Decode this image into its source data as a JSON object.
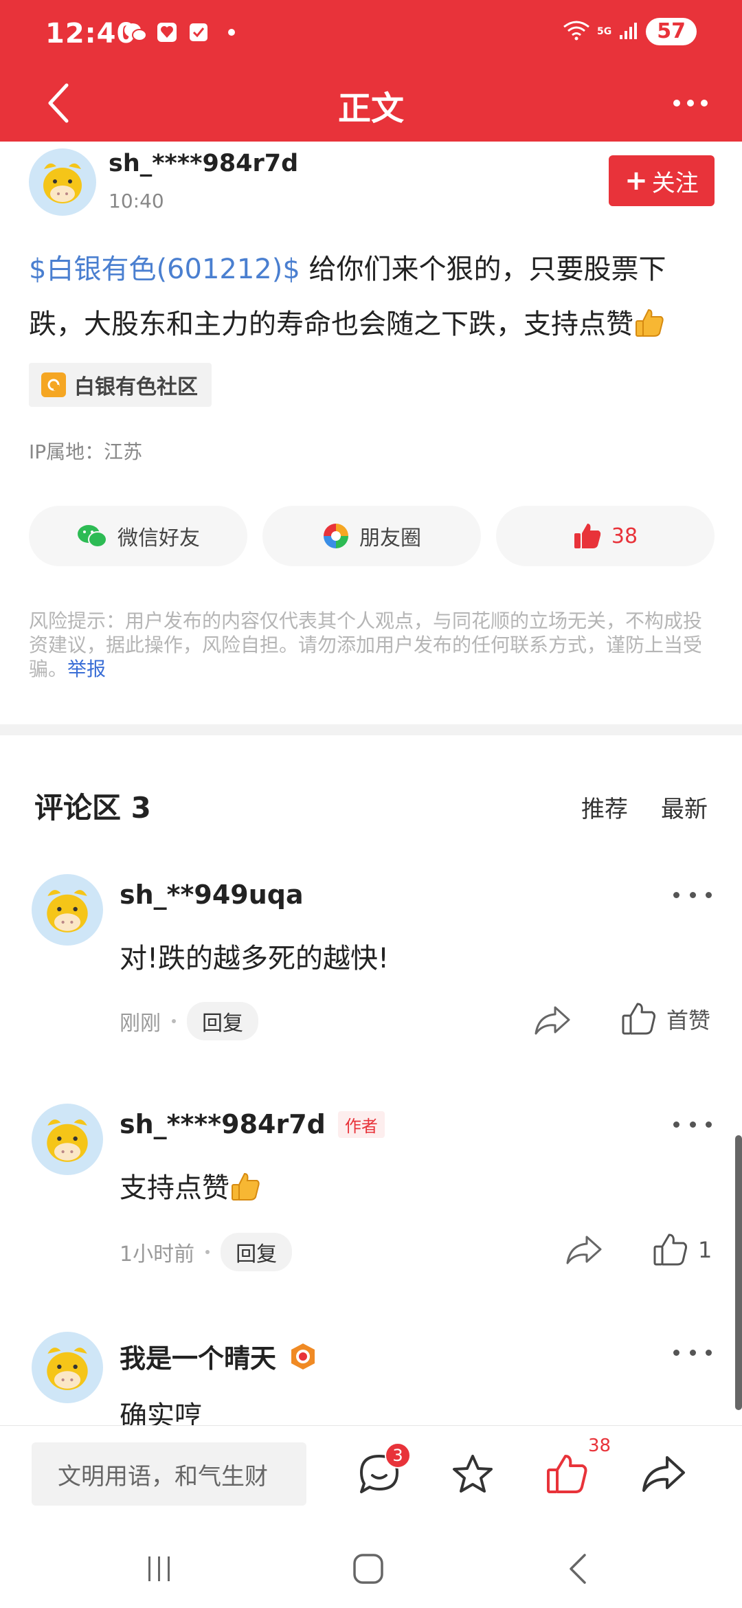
{
  "status_bar": {
    "time": "12:40",
    "network_label": "5G",
    "battery": "57"
  },
  "header": {
    "title": "正文"
  },
  "post": {
    "author": "sh_****984r7d",
    "time": "10:40",
    "follow_label": "关注",
    "stock_tag": "$白银有色(601212)$",
    "text": " 给你们来个狠的，只要股票下跌，大股东和主力的寿命也会随之下跌，支持点赞",
    "community": "白银有色社区",
    "ip_location": "IP属地：江苏",
    "share": {
      "wechat": "微信好友",
      "moments": "朋友圈",
      "likes": "38"
    },
    "risk_notice": "风险提示：用户发布的内容仅代表其个人观点，与同花顺的立场无关，不构成投资建议，据此操作，风险自担。请勿添加用户发布的任何联系方式，谨防上当受骗。",
    "report_label": "举报"
  },
  "comments_section": {
    "title": "评论区 3",
    "sort_recommend": "推荐",
    "sort_newest": "最新",
    "comments": [
      {
        "name": "sh_**949uqa",
        "text": "对!跌的越多死的越快!",
        "time": "刚刚",
        "reply": "回复",
        "like": "首赞"
      },
      {
        "name": "sh_****984r7d",
        "badge": "作者",
        "text": "支持点赞",
        "time": "1小时前",
        "reply": "回复",
        "like": "1"
      },
      {
        "name": "我是一个晴天",
        "text": "确实哼"
      }
    ]
  },
  "bottom_bar": {
    "input_placeholder": "文明用语，和气生财",
    "comment_count": "3",
    "like_count": "38"
  },
  "colors": {
    "brand_red": "#e8333a",
    "link_blue": "#4a7fd0"
  }
}
